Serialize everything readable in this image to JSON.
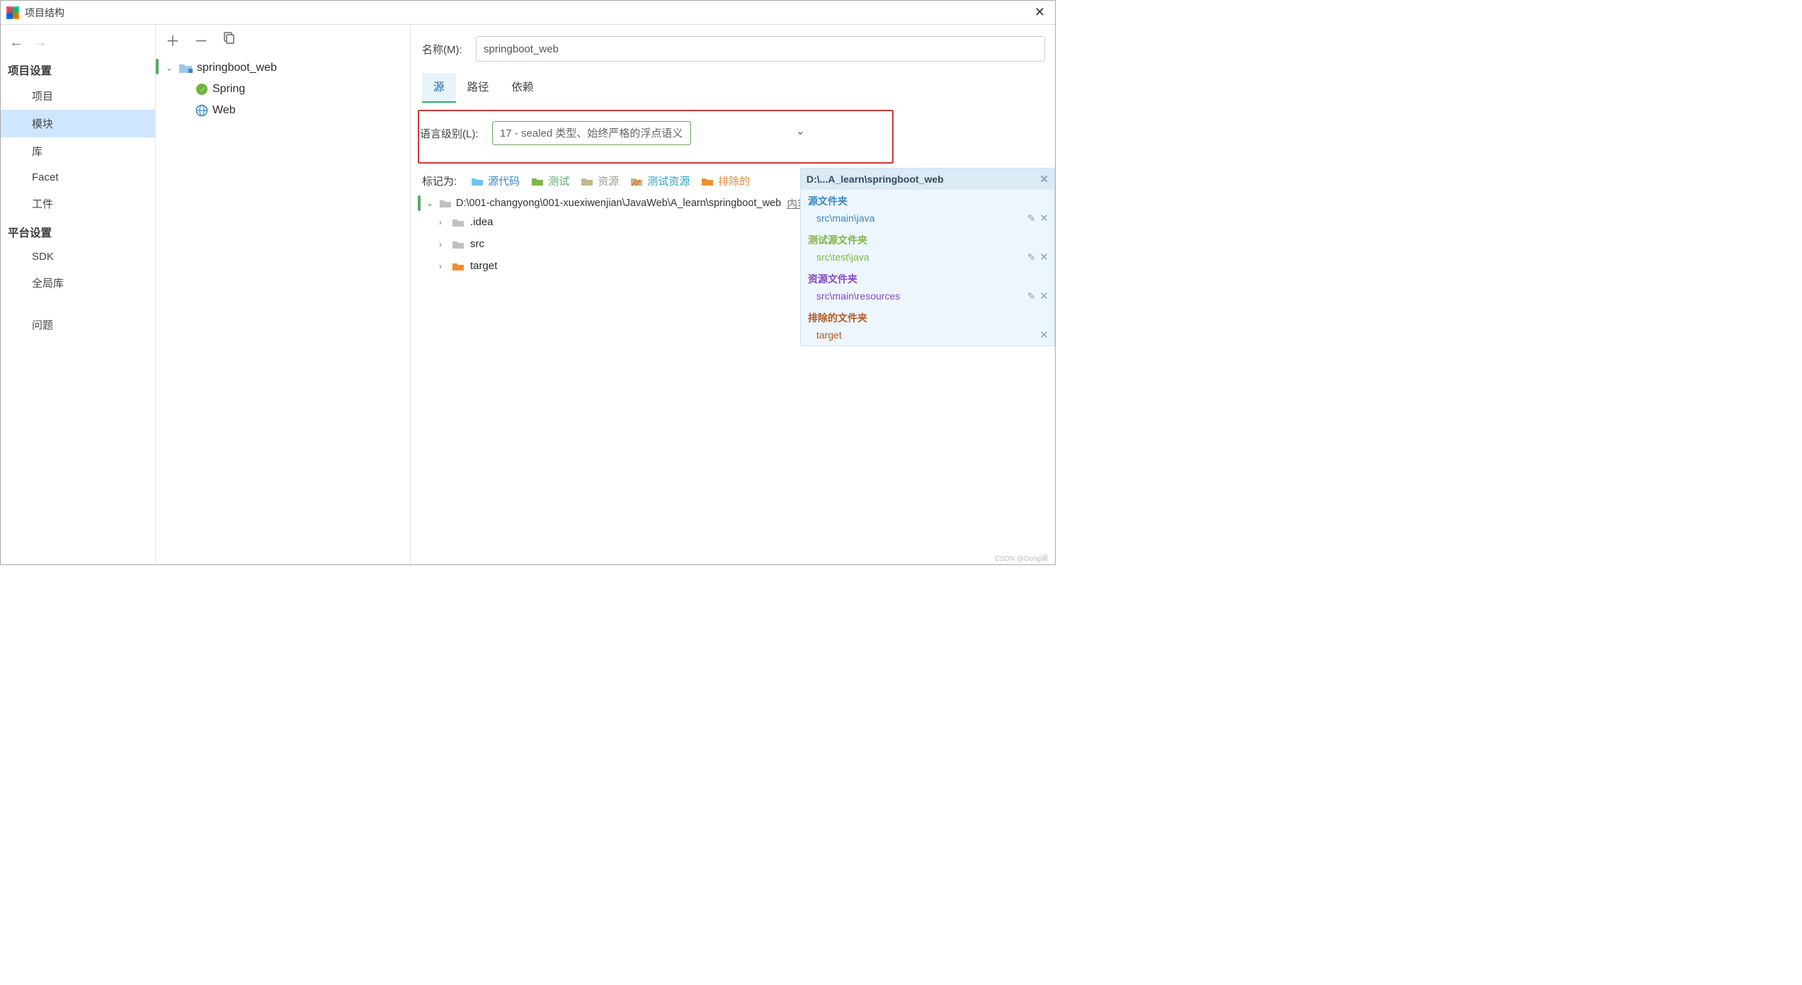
{
  "window": {
    "title": "项目结构"
  },
  "sidebar": {
    "sections": [
      {
        "header": "项目设置",
        "items": [
          {
            "label": "项目"
          },
          {
            "label": "模块",
            "selected": true
          },
          {
            "label": "库"
          },
          {
            "label": "Facet"
          },
          {
            "label": "工件"
          }
        ]
      },
      {
        "header": "平台设置",
        "items": [
          {
            "label": "SDK"
          },
          {
            "label": "全局库"
          }
        ]
      },
      {
        "header": "",
        "items": [
          {
            "label": "问题"
          }
        ]
      }
    ]
  },
  "moduleTree": {
    "root": "springboot_web",
    "children": [
      {
        "label": "Spring",
        "icon": "spring"
      },
      {
        "label": "Web",
        "icon": "web"
      }
    ]
  },
  "detail": {
    "nameLabel": "名称(M):",
    "name": "springboot_web",
    "tabs": [
      {
        "label": "源",
        "active": true
      },
      {
        "label": "路径"
      },
      {
        "label": "依赖"
      }
    ],
    "langLabel": "语言级别(L):",
    "langValue": "17 - sealed 类型、始终严格的浮点语义",
    "markAsLabel": "标记为:",
    "markAs": [
      {
        "label": "源代码",
        "colorClass": "mark-blue",
        "folderColor": "#6ec4ef"
      },
      {
        "label": "测试",
        "colorClass": "mark-green",
        "folderColor": "#7fb648"
      },
      {
        "label": "资源",
        "colorClass": "mark-gray",
        "folderColor": "#c2b98a"
      },
      {
        "label": "测试资源",
        "colorClass": "mark-teal",
        "folderColor": "#2aa4b8",
        "stripes": true
      },
      {
        "label": "排除的",
        "colorClass": "mark-orange",
        "folderColor": "#ef9030"
      }
    ],
    "contentRootPath": "D:\\001-changyong\\001-xuexiwenjian\\JavaWeb\\A_learn\\springboot_web",
    "contentRootSuffix": "内容根 (C)",
    "folders": [
      {
        "name": ".idea",
        "color": "#c0c0c0"
      },
      {
        "name": "src",
        "color": "#c0c0c0"
      },
      {
        "name": "target",
        "color": "#ef9030"
      }
    ]
  },
  "crootPanel": {
    "title": "D:\\...A_learn\\springboot_web",
    "sections": [
      {
        "header": "源文件夹",
        "colorClass": "c-blue",
        "item": "src\\main\\java",
        "editable": true
      },
      {
        "header": "测试源文件夹",
        "colorClass": "c-green",
        "item": "src\\test\\java",
        "editable": true
      },
      {
        "header": "资源文件夹",
        "colorClass": "c-purple",
        "item": "src\\main\\resources",
        "editable": true
      },
      {
        "header": "排除的文件夹",
        "colorClass": "c-rust",
        "item": "target",
        "editable": false
      }
    ]
  },
  "watermark": "CSDN @Dong调"
}
